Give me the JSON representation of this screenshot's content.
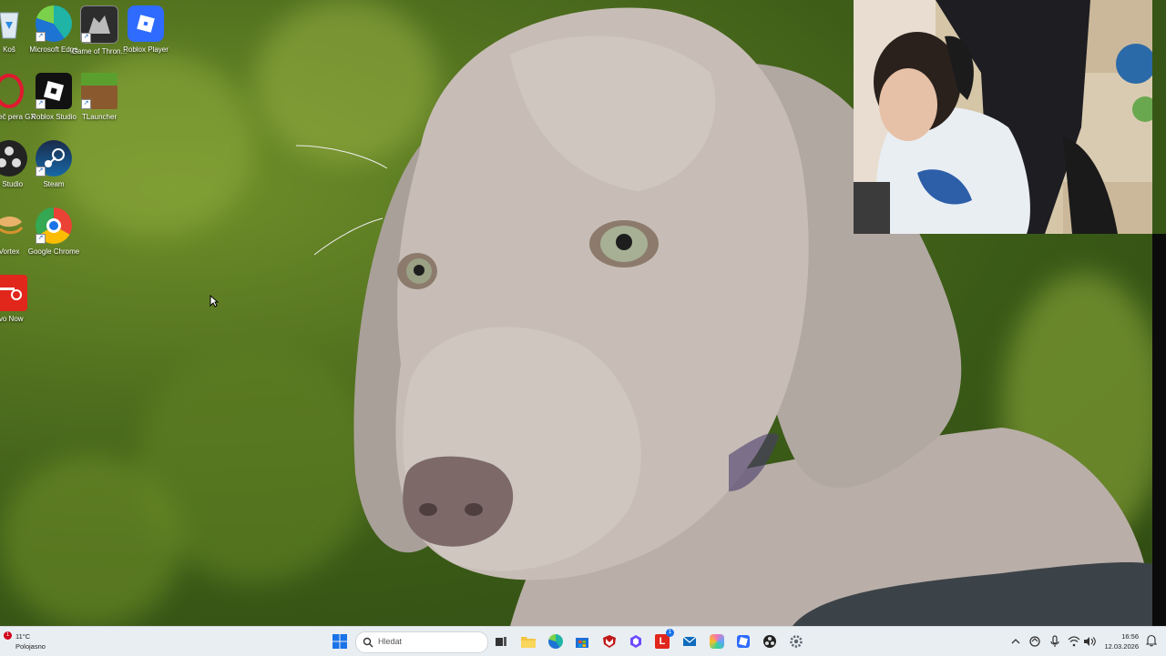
{
  "desktop": {
    "icons": [
      {
        "name": "recycle-bin",
        "label": "Koš"
      },
      {
        "name": "edge",
        "label": "Microsoft Edge"
      },
      {
        "name": "game-of-thrones",
        "label": "Game of Thron..."
      },
      {
        "name": "roblox-player",
        "label": "Roblox Player"
      },
      {
        "name": "opera-gx",
        "label": "ohlížeč pera GX"
      },
      {
        "name": "roblox-studio",
        "label": "Roblox Studio"
      },
      {
        "name": "tlauncher",
        "label": "TLauncher"
      },
      {
        "name": "obs-studio",
        "label": "S Studio"
      },
      {
        "name": "steam",
        "label": "Steam"
      },
      {
        "name": "vortex",
        "label": "Vortex"
      },
      {
        "name": "google-chrome",
        "label": "Google Chrome"
      },
      {
        "name": "lenovo-now",
        "label": "ovo Now"
      }
    ]
  },
  "taskbar": {
    "weather_temp": "11°C",
    "weather_desc": "Polojasno",
    "weather_badge": "1",
    "search_placeholder": "Hledat",
    "badge_count": "1",
    "time": "16:56",
    "date": "12.03.2026"
  },
  "colors": {
    "taskbar_bg": "#e9eef2",
    "windows_blue": "#1a73e8",
    "desktop_green": "#4f6e1e"
  }
}
